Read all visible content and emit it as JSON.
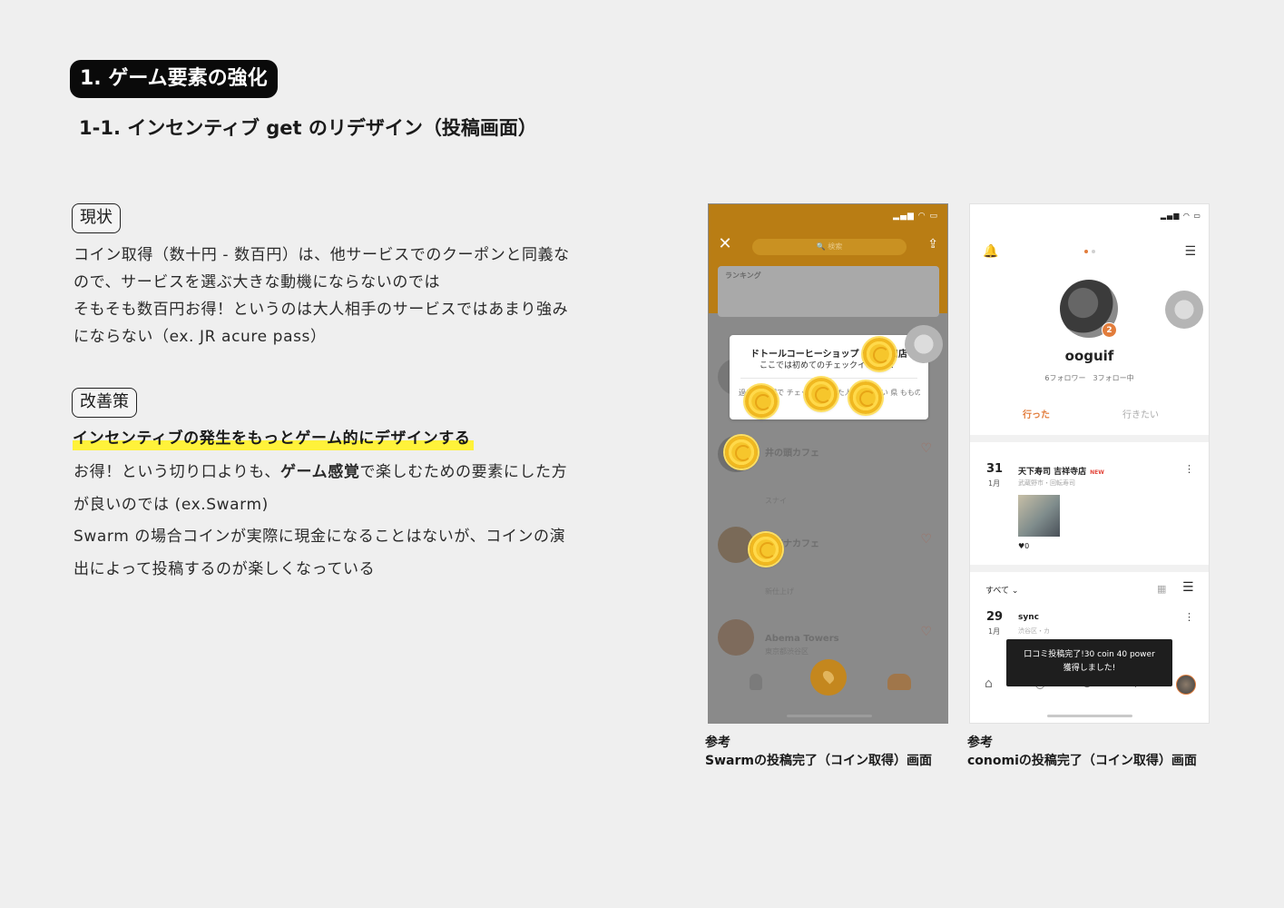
{
  "section": {
    "badge": "1. ゲーム要素の強化"
  },
  "subsection": {
    "title": "1-1. インセンティブ get のリデザイン（投稿画面）"
  },
  "current": {
    "tag": "現状",
    "lines": [
      "コイン取得（数十円 - 数百円）は、他サービスでのクーポンと同義な",
      "ので、サービスを選ぶ大きな動機にならないのでは",
      "そもそも数百円お得！というのは大人相手のサービスではあまり強み",
      "にならない（ex. JR acure pass）"
    ]
  },
  "improvement": {
    "tag": "改善策",
    "highlight": "インセンティブの発生をもっとゲーム的にデザインする",
    "line1_pre": "お得！という切り口よりも、",
    "line1_bold": "ゲーム感覚",
    "line1_post": "で楽しむための要素にした方",
    "line2": "が良いのでは (ex.Swarm)",
    "line3": "Swarm の場合コインが実際に現金になることはないが、コインの演",
    "line4": "出によって投稿するのが楽しくなっている"
  },
  "swarm_screen": {
    "status_icons": "▂▄▆ ◠ ▭",
    "close_icon": "✕",
    "search_placeholder": "🔍 検索",
    "share_icon": "⇪",
    "ranking_label": "ランキング",
    "popup_title": "ドトールコーヒーショップ 吉祥寺口店",
    "popup_sub": "ここでは初めてのチェックインです！",
    "popup_row": "過去30日間で チェックインした人が一番多い 県 もものす",
    "row1_title": "井の頭カフェ",
    "row1_sub": "スナイ",
    "row2_title": "東京ナカフェ",
    "row2_sub": "新仕上げ",
    "row3_title": "Abema Towers",
    "row3_sub": "東京都渋谷区",
    "heart_icon": "♡",
    "accent": "#c4871e"
  },
  "conomi_screen": {
    "status_icons": "▂▄▆ ◠ ▭",
    "bell_icon": "🔔",
    "menu_icon": "☰",
    "badge_count": "2",
    "username": "ooguif",
    "follow_text": "6フォロワー　3フォロー中",
    "tab_went": "行った",
    "tab_want": "行きたい",
    "post1": {
      "day": "31",
      "month": "1月",
      "title": "天下寿司 吉祥寺店",
      "new": "NEW",
      "sub": "武蔵野市・回転寿司",
      "likes": "♥0"
    },
    "filter": "すべて ⌄",
    "grid_icon": "▦",
    "list_icon": "☰",
    "post2": {
      "day": "29",
      "month": "1月",
      "title": "sync",
      "sub": "渋谷区・カ"
    },
    "kebab_icon": "⋮",
    "toast_line1": "口コミ投稿完了!30 coin 40 power",
    "toast_line2": "獲得しました!",
    "nav_home": "⌂",
    "nav_search": "○",
    "nav_add": "⊕",
    "nav_trophy": "♆",
    "accent": "#e27d3c"
  },
  "captions": {
    "swarm_line1": "参考",
    "swarm_line2": "Swarmの投稿完了（コイン取得）画面",
    "conomi_line1": "参考",
    "conomi_line2": "conomiの投稿完了（コイン取得）画面"
  }
}
